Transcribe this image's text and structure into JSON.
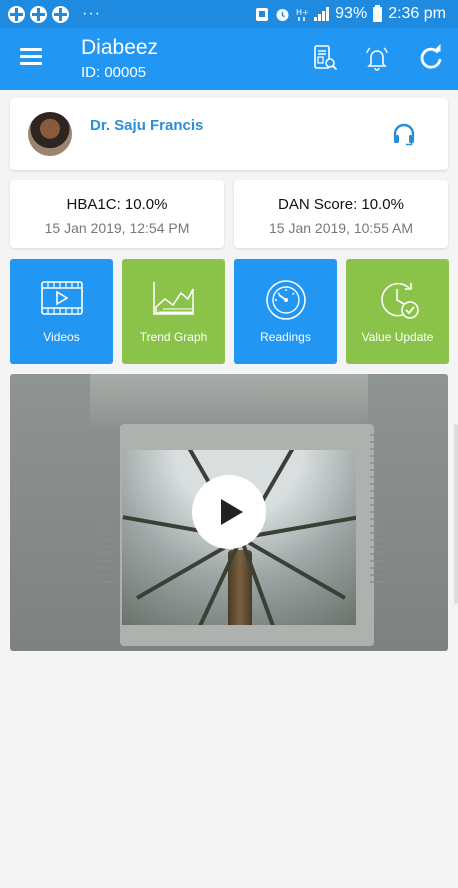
{
  "status_bar": {
    "battery": "93%",
    "time": "2:36 pm"
  },
  "header": {
    "title": "Diabeez",
    "subtitle": "ID: 00005"
  },
  "doctor": {
    "name": "Dr. Saju Francis"
  },
  "scores": [
    {
      "title": "HBA1C: 10.0%",
      "date": "15 Jan 2019, 12:54 PM"
    },
    {
      "title": "DAN Score: 10.0%",
      "date": "15 Jan 2019, 10:55 AM"
    }
  ],
  "tiles": [
    {
      "label": "Videos",
      "color": "#2196f3",
      "icon": "video-icon"
    },
    {
      "label": "Trend Graph",
      "color": "#8bc34a",
      "icon": "trend-graph-icon"
    },
    {
      "label": "Readings",
      "color": "#2196f3",
      "icon": "gauge-icon"
    },
    {
      "label": "Value Update",
      "color": "#8bc34a",
      "icon": "value-update-icon"
    }
  ],
  "colors": {
    "app_bar": "#2196f3",
    "status_bar": "#1f8be0",
    "accent_green": "#8bc34a",
    "doctor_name": "#2a8fd6"
  }
}
